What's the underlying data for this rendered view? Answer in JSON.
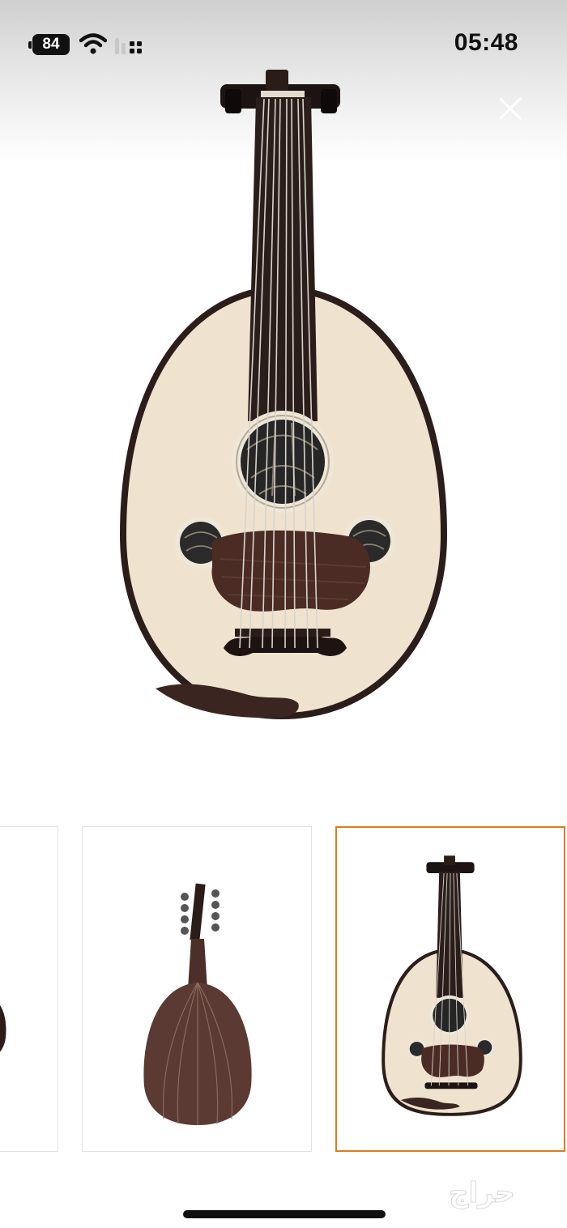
{
  "status_bar": {
    "battery_level": "84",
    "time": "05:48",
    "icons": [
      "wifi-icon",
      "cellular-signal-icon"
    ]
  },
  "viewer": {
    "close_icon": "close-icon",
    "main_image": "oud-front-view",
    "thumbnails": [
      {
        "image": "oud-partial-side-view",
        "selected": false
      },
      {
        "image": "oud-back-view",
        "selected": false
      },
      {
        "image": "oud-front-view",
        "selected": true
      }
    ],
    "selected_border_color": "#e07b1d"
  },
  "watermark": {
    "text": "حراج",
    "color": "#ffffff"
  }
}
